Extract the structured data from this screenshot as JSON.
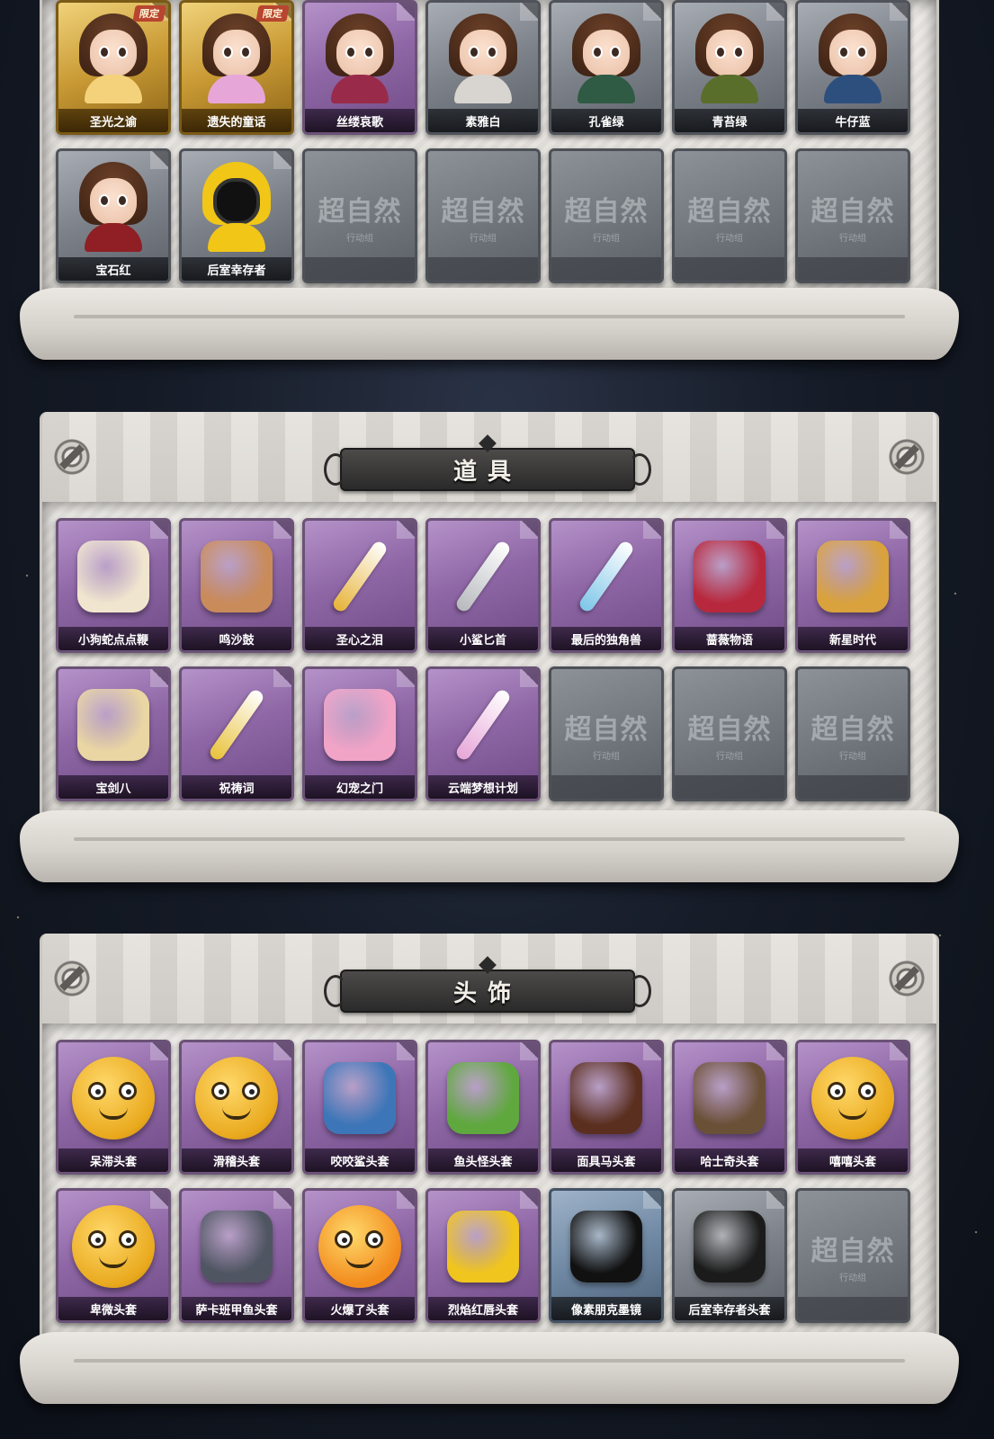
{
  "sections": [
    {
      "title": "",
      "cards": [
        {
          "label": "圣光之谕",
          "style": "gold",
          "badge": "限定",
          "art": "girl",
          "tone": "#f4d27b"
        },
        {
          "label": "遗失的童话",
          "style": "gold",
          "badge": "限定",
          "art": "girl",
          "tone": "#e7a6d8"
        },
        {
          "label": "丝缕哀歌",
          "style": "purple",
          "badge": "",
          "art": "girl",
          "tone": "#9a2a4a"
        },
        {
          "label": "素雅白",
          "style": "grey",
          "badge": "",
          "art": "girl",
          "tone": "#d8d4cf"
        },
        {
          "label": "孔雀绿",
          "style": "grey",
          "badge": "",
          "art": "girl",
          "tone": "#2f5a43"
        },
        {
          "label": "青苔绿",
          "style": "grey",
          "badge": "",
          "art": "girl",
          "tone": "#5a6e2c"
        },
        {
          "label": "牛仔蓝",
          "style": "grey",
          "badge": "",
          "art": "girl",
          "tone": "#2c4f7e"
        },
        {
          "label": "宝石红",
          "style": "grey",
          "badge": "",
          "art": "girl",
          "tone": "#8f1f24"
        },
        {
          "label": "后室幸存者",
          "style": "grey",
          "badge": "",
          "art": "hazmat",
          "tone": "#f1c617"
        },
        {
          "label": "",
          "style": "empty"
        },
        {
          "label": "",
          "style": "empty"
        },
        {
          "label": "",
          "style": "empty"
        },
        {
          "label": "",
          "style": "empty"
        },
        {
          "label": "",
          "style": "empty"
        }
      ]
    },
    {
      "title": "道具",
      "cards": [
        {
          "label": "小狗蛇点点鞭",
          "style": "purple",
          "art": "blob",
          "tone": "#f0e6cf"
        },
        {
          "label": "鸣沙鼓",
          "style": "purple",
          "art": "blob",
          "tone": "#c98b5a"
        },
        {
          "label": "圣心之泪",
          "style": "purple",
          "art": "blade",
          "tone": "#e7b43a"
        },
        {
          "label": "小鲨匕首",
          "style": "purple",
          "art": "blade",
          "tone": "#b7b9bd"
        },
        {
          "label": "最后的独角兽",
          "style": "purple",
          "art": "blade",
          "tone": "#7fc6e8"
        },
        {
          "label": "蔷薇物语",
          "style": "purple",
          "art": "blob",
          "tone": "#b8283c"
        },
        {
          "label": "新星时代",
          "style": "purple",
          "art": "blob",
          "tone": "#d9a23c"
        },
        {
          "label": "宝剑八",
          "style": "purple",
          "art": "blob",
          "tone": "#e9d6a3"
        },
        {
          "label": "祝祷词",
          "style": "purple",
          "art": "blade",
          "tone": "#e8c23c"
        },
        {
          "label": "幻宠之门",
          "style": "purple",
          "art": "blob",
          "tone": "#f2a4c7"
        },
        {
          "label": "云端梦想计划",
          "style": "purple",
          "art": "blade",
          "tone": "#e7a6d8"
        },
        {
          "label": "",
          "style": "empty"
        },
        {
          "label": "",
          "style": "empty"
        },
        {
          "label": "",
          "style": "empty"
        }
      ]
    },
    {
      "title": "头饰",
      "cards": [
        {
          "label": "呆滞头套",
          "style": "purple",
          "art": "face"
        },
        {
          "label": "滑稽头套",
          "style": "purple",
          "art": "face"
        },
        {
          "label": "咬咬鲨头套",
          "style": "purple",
          "art": "blob",
          "tone": "#3c76b8"
        },
        {
          "label": "鱼头怪头套",
          "style": "purple",
          "art": "blob",
          "tone": "#5fa83e"
        },
        {
          "label": "面具马头套",
          "style": "purple",
          "art": "blob",
          "tone": "#5a2f1f"
        },
        {
          "label": "哈士奇头套",
          "style": "purple",
          "art": "blob",
          "tone": "#6a5036"
        },
        {
          "label": "嘻嘻头套",
          "style": "purple",
          "art": "face"
        },
        {
          "label": "卑微头套",
          "style": "purple",
          "art": "face"
        },
        {
          "label": "萨卡班甲鱼头套",
          "style": "purple",
          "art": "blob",
          "tone": "#4f5662"
        },
        {
          "label": "火爆了头套",
          "style": "purple",
          "art": "face",
          "tone": "#f28a1c"
        },
        {
          "label": "烈焰红唇头套",
          "style": "purple",
          "art": "blob",
          "tone": "#f0c51d"
        },
        {
          "label": "像素朋克墨镜",
          "style": "blue",
          "art": "blob",
          "tone": "#111111"
        },
        {
          "label": "后室幸存者头套",
          "style": "grey",
          "art": "blob",
          "tone": "#1b1b1b"
        },
        {
          "label": "",
          "style": "empty"
        }
      ]
    }
  ],
  "placeholder": {
    "big": "超自然",
    "small": "行动组"
  },
  "colors": {
    "banner": "#2b2a2a",
    "purple": "#8f67a6",
    "gold": "#c99a34",
    "limited_badge": "#b8452f"
  }
}
